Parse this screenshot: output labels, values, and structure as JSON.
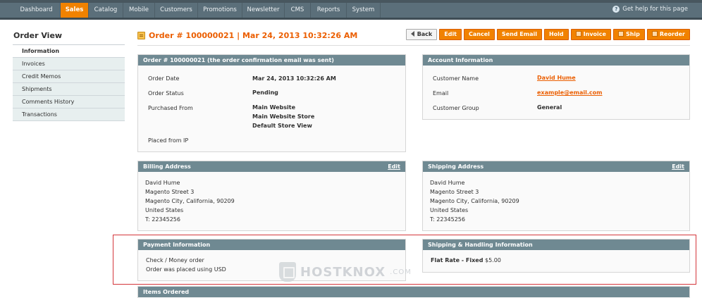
{
  "nav": {
    "items": [
      {
        "label": "Dashboard"
      },
      {
        "label": "Sales"
      },
      {
        "label": "Catalog"
      },
      {
        "label": "Mobile"
      },
      {
        "label": "Customers"
      },
      {
        "label": "Promotions"
      },
      {
        "label": "Newsletter"
      },
      {
        "label": "CMS"
      },
      {
        "label": "Reports"
      },
      {
        "label": "System"
      }
    ],
    "help_label": "Get help for this page"
  },
  "sidebar": {
    "title": "Order View",
    "items": [
      {
        "label": "Information"
      },
      {
        "label": "Invoices"
      },
      {
        "label": "Credit Memos"
      },
      {
        "label": "Shipments"
      },
      {
        "label": "Comments History"
      },
      {
        "label": "Transactions"
      }
    ]
  },
  "header": {
    "title": "Order # 100000021 | Mar 24, 2013 10:32:26 AM",
    "buttons": {
      "back": "Back",
      "edit": "Edit",
      "cancel": "Cancel",
      "send_email": "Send Email",
      "hold": "Hold",
      "invoice": "Invoice",
      "ship": "Ship",
      "reorder": "Reorder"
    }
  },
  "order_box": {
    "title": "Order # 100000021 (the order confirmation email was sent)",
    "date_label": "Order Date",
    "date_value": "Mar 24, 2013 10:32:26 AM",
    "status_label": "Order Status",
    "status_value": "Pending",
    "purchased_label": "Purchased From",
    "purchased_lines": [
      "Main Website",
      "Main Website Store",
      "Default Store View"
    ],
    "ip_label": "Placed from IP"
  },
  "account_box": {
    "title": "Account Information",
    "name_label": "Customer Name",
    "name_value": "David Hume",
    "email_label": "Email",
    "email_value": "example@email.com",
    "group_label": "Customer Group",
    "group_value": "General"
  },
  "billing_box": {
    "title": "Billing Address",
    "edit_label": "Edit",
    "lines": [
      "David Hume",
      "Magento Street 3",
      "Magento City, California, 90209",
      "United States",
      "T: 22345256"
    ]
  },
  "shipping_box": {
    "title": "Shipping Address",
    "edit_label": "Edit",
    "lines": [
      "David Hume",
      "Magento Street 3",
      "Magento City, California, 90209",
      "United States",
      "T: 22345256"
    ]
  },
  "payment_box": {
    "title": "Payment Information",
    "lines": [
      "Check / Money order",
      "Order was placed using USD"
    ]
  },
  "shipping_handling_box": {
    "title": "Shipping & Handling Information",
    "method": "Flat Rate - Fixed",
    "price": "$5.00"
  },
  "items_box": {
    "title": "Items Ordered"
  },
  "watermark": {
    "text": "HOSTKNOX",
    "suffix": ".COM"
  },
  "colors": {
    "accent": "#f18200",
    "title_orange": "#eb5e00",
    "box_header": "#6f8992",
    "highlight_red": "#d4363b"
  }
}
